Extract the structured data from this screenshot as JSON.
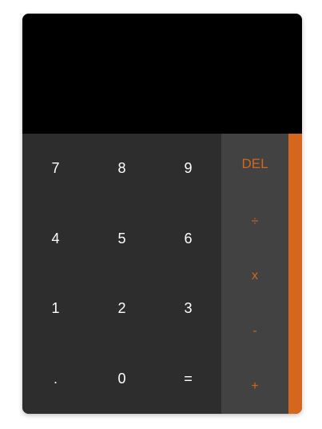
{
  "display": {
    "value": ""
  },
  "numpad": {
    "keys": [
      "7",
      "8",
      "9",
      "4",
      "5",
      "6",
      "1",
      "2",
      "3",
      ".",
      "0",
      "="
    ]
  },
  "operators": {
    "keys": [
      "DEL",
      "÷",
      "x",
      "-",
      "+"
    ]
  },
  "colors": {
    "accent": "#d4661e",
    "display_bg": "#000000",
    "numpad_bg": "#2d2d2d",
    "operator_bg": "#424242",
    "digit_text": "#ffffff"
  }
}
